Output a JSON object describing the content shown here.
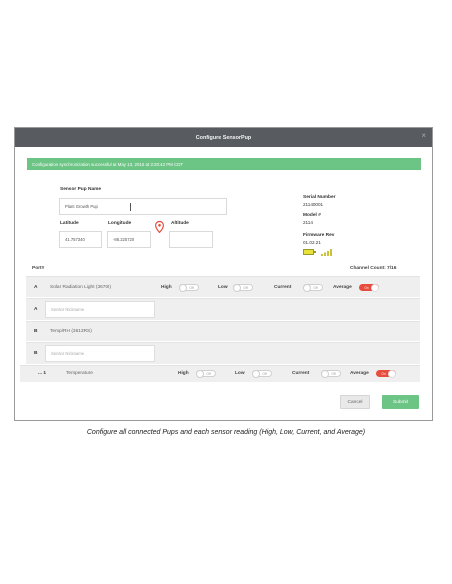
{
  "dialog": {
    "title": "Configure SensorPup",
    "close_glyph": "×",
    "alert": "Configuration synchronization successful at May 13, 2015 at 3:20:42 PM CDT"
  },
  "pup": {
    "name_label": "Sensor Pup Name",
    "name_value": "Plant Growth Pup",
    "latitude_label": "Latitude",
    "latitude_value": "41.757340",
    "longitude_label": "Longitude",
    "longitude_value": "-88.225720",
    "altitude_label": "Altitude",
    "altitude_value": "",
    "location_icon": "map-pin-icon"
  },
  "device": {
    "serial_label": "Serial Number",
    "serial_value": "21140001",
    "model_label": "Model #",
    "model_value": "2114",
    "firmware_label": "Firmware Rev",
    "firmware_value": "01.02.21",
    "battery_icon": "battery-icon",
    "signal_icon": "signal-icon"
  },
  "table": {
    "port_header": "Port#",
    "channel_count": "Channel Count: 7/16",
    "toggle_off": "Off",
    "toggle_on": "On",
    "labels": {
      "high": "High",
      "low": "Low",
      "current": "Current",
      "average": "Average"
    },
    "rows": [
      {
        "port": "A",
        "name": "Solar Radiation Light (3670I)"
      },
      {
        "port": "A",
        "nickname_placeholder": "Sensor Nickname"
      },
      {
        "port": "B",
        "name": "Temp/RH (3613RS)"
      },
      {
        "port": "B",
        "nickname_placeholder": "Sensor Nickname"
      },
      {
        "port": "... 1",
        "name": "Temperature"
      }
    ]
  },
  "footer": {
    "cancel": "Cancel",
    "submit": "Submit"
  },
  "caption": "Configure all connected Pups and each sensor reading (High, Low, Current, and Average)",
  "colors": {
    "accent_green": "#6cc485",
    "toggle_on_red": "#e74c3c",
    "titlebar": "#585c60"
  }
}
